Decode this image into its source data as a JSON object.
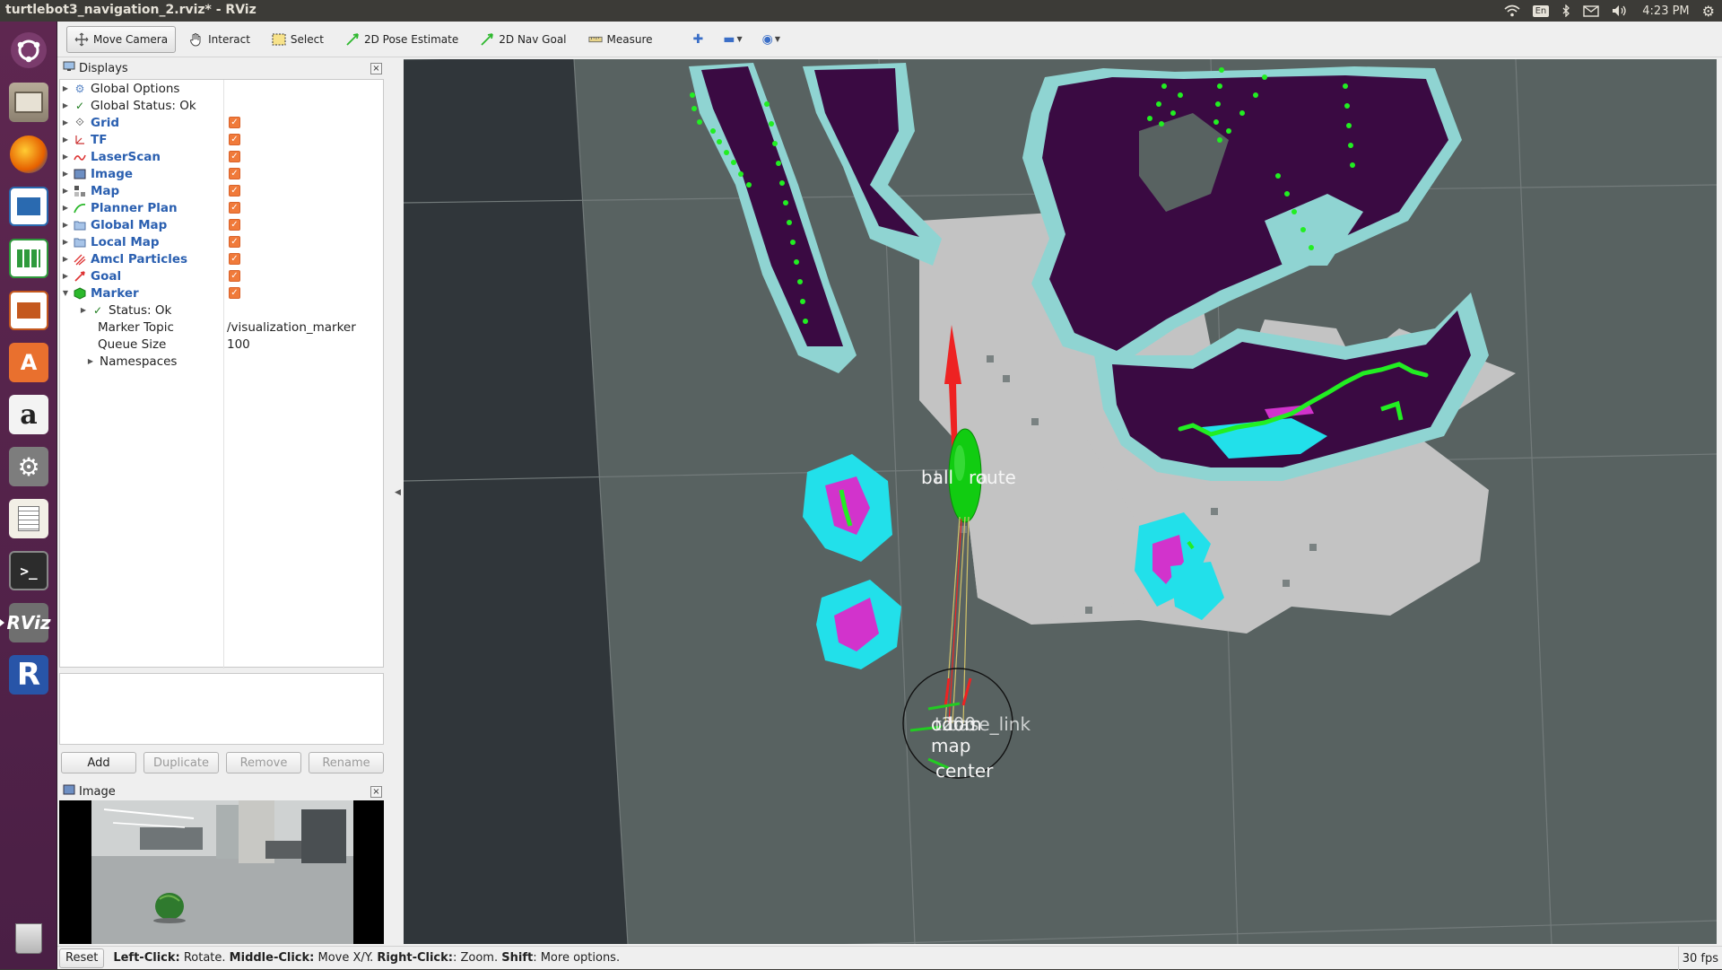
{
  "window": {
    "title": "turtlebot3_navigation_2.rviz* - RViz"
  },
  "system_tray": {
    "keyboard": "En",
    "time": "4:23 PM"
  },
  "launcher": {
    "items": [
      "ubuntu-dash-icon",
      "files-icon",
      "firefox-icon",
      "writer-icon",
      "calc-icon",
      "impress-icon",
      "software-center-icon",
      "amazon-icon",
      "system-settings-icon",
      "text-editor-icon",
      "terminal-icon",
      "rviz-icon",
      "r-app-icon",
      "trash-icon"
    ],
    "rviz_label": "RViz",
    "r_label": "R",
    "amazon_label": "a"
  },
  "toolbar": {
    "move_camera": "Move Camera",
    "interact": "Interact",
    "select": "Select",
    "pose_estimate": "2D Pose Estimate",
    "nav_goal": "2D Nav Goal",
    "measure": "Measure"
  },
  "displays": {
    "title": "Displays",
    "rows": [
      {
        "name": "Global Options",
        "checked": null
      },
      {
        "name": "Global Status: Ok",
        "checked": null
      },
      {
        "name": "Grid",
        "checked": true
      },
      {
        "name": "TF",
        "checked": true
      },
      {
        "name": "LaserScan",
        "checked": true
      },
      {
        "name": "Image",
        "checked": true
      },
      {
        "name": "Map",
        "checked": true
      },
      {
        "name": "Planner Plan",
        "checked": true
      },
      {
        "name": "Global Map",
        "checked": true
      },
      {
        "name": "Local Map",
        "checked": true
      },
      {
        "name": "Amcl Particles",
        "checked": true
      },
      {
        "name": "Goal",
        "checked": true
      },
      {
        "name": "Marker",
        "checked": true
      }
    ],
    "marker_children": {
      "status": "Status: Ok",
      "topic_label": "Marker Topic",
      "topic_value": "/visualization_marker",
      "queue_label": "Queue Size",
      "queue_value": "100",
      "namespaces": "Namespaces"
    },
    "buttons": {
      "add": "Add",
      "duplicate": "Duplicate",
      "remove": "Remove",
      "rename": "Rename"
    }
  },
  "image_panel": {
    "title": "Image"
  },
  "view3d": {
    "labels": {
      "ball": "ball",
      "ball_overlap": "t",
      "route": "route",
      "route_overlap": "a",
      "base_link": "base_link",
      "odom": "odom",
      "t200": "t200",
      "map": "map",
      "center": "center"
    }
  },
  "statusbar": {
    "reset": "Reset",
    "left_click": "Left-Click:",
    "left_click_action": " Rotate. ",
    "middle_click": "Middle-Click:",
    "middle_click_action": " Move X/Y. ",
    "right_click": "Right-Click:",
    "right_click_action": ": Zoom. ",
    "shift": "Shift",
    "shift_action": ": More options.",
    "fps": "30 fps"
  },
  "colors": {
    "launcher_bg": "#5e2750",
    "topbar_bg": "#3c3b37",
    "checkbox": "#f07a3a",
    "map_free": "#c3c3c3",
    "map_unknown": "#586261",
    "map_occupied": "#3a0a42",
    "costmap_cyan": "#22e0ea",
    "costmap_magenta": "#d233cc",
    "laser_green": "#22ee22",
    "goal_arrow": "#ee2222",
    "marker_ball": "#11cc11"
  }
}
